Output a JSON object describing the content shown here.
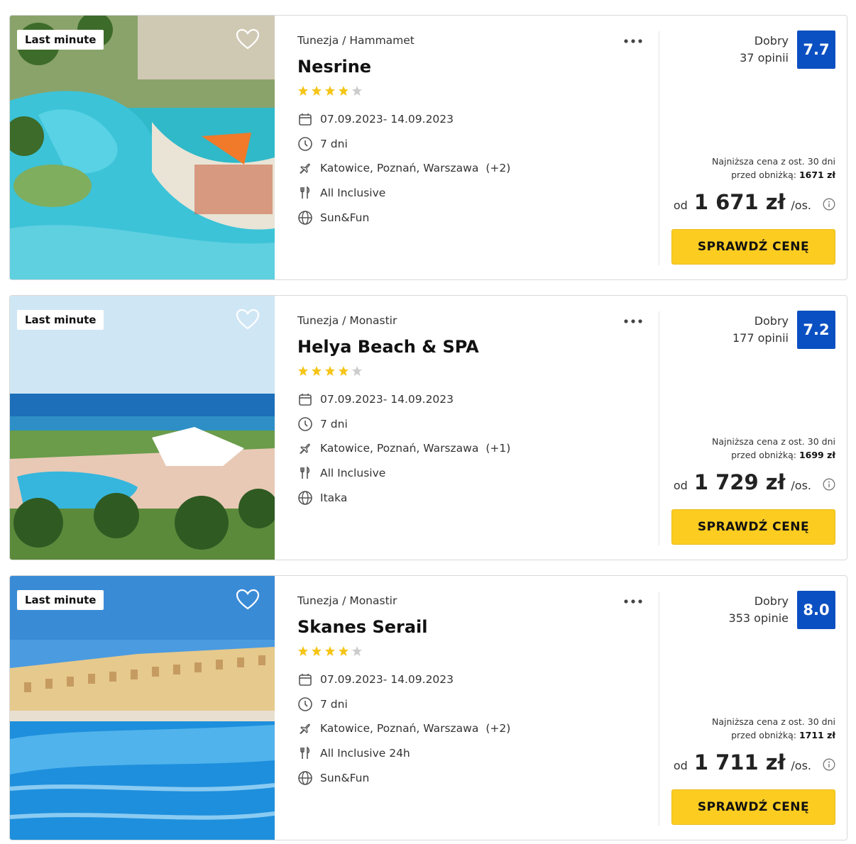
{
  "offers": [
    {
      "badge": "Last minute",
      "location": "Tunezja / Hammamet",
      "name": "Nesrine",
      "stars": 4,
      "dates": "07.09.2023- 14.09.2023",
      "duration": "7 dni",
      "airports": "Katowice, Poznań, Warszawa",
      "airports_extra": "(+2)",
      "board": "All Inclusive",
      "operator": "Sun&Fun",
      "rating_label": "Dobry",
      "reviews": "37 opinii",
      "score": "7.7",
      "lowest_line1": "Najniższa cena z ost. 30 dni",
      "lowest_prefix": "przed obniżką:",
      "lowest_price": "1671 zł",
      "price_prefix": "od",
      "price": "1 671 zł",
      "price_suffix": "/os.",
      "cta": "SPRAWDŹ CENĘ"
    },
    {
      "badge": "Last minute",
      "location": "Tunezja / Monastir",
      "name": "Helya Beach & SPA",
      "stars": 4,
      "dates": "07.09.2023- 14.09.2023",
      "duration": "7 dni",
      "airports": "Katowice, Poznań, Warszawa",
      "airports_extra": "(+1)",
      "board": "All Inclusive",
      "operator": "Itaka",
      "rating_label": "Dobry",
      "reviews": "177 opinii",
      "score": "7.2",
      "lowest_line1": "Najniższa cena z ost. 30 dni",
      "lowest_prefix": "przed obniżką:",
      "lowest_price": "1699 zł",
      "price_prefix": "od",
      "price": "1 729 zł",
      "price_suffix": "/os.",
      "cta": "SPRAWDŹ CENĘ"
    },
    {
      "badge": "Last minute",
      "location": "Tunezja / Monastir",
      "name": "Skanes Serail",
      "stars": 4,
      "dates": "07.09.2023- 14.09.2023",
      "duration": "7 dni",
      "airports": "Katowice, Poznań, Warszawa",
      "airports_extra": "(+2)",
      "board": "All Inclusive 24h",
      "operator": "Sun&Fun",
      "rating_label": "Dobry",
      "reviews": "353 opinie",
      "score": "8.0",
      "lowest_line1": "Najniższa cena z ost. 30 dni",
      "lowest_prefix": "przed obniżką:",
      "lowest_price": "1711 zł",
      "price_prefix": "od",
      "price": "1 711 zł",
      "price_suffix": "/os.",
      "cta": "SPRAWDŹ CENĘ"
    }
  ],
  "colors": {
    "score_bg": "#0b50c2",
    "cta_bg": "#fccc21",
    "star_on": "#f5c518",
    "star_off": "#cccccc"
  },
  "icons": [
    "heart-icon",
    "more-dots-icon",
    "star-icon",
    "calendar-icon",
    "clock-icon",
    "plane-icon",
    "cutlery-icon",
    "globe-icon",
    "info-icon"
  ]
}
